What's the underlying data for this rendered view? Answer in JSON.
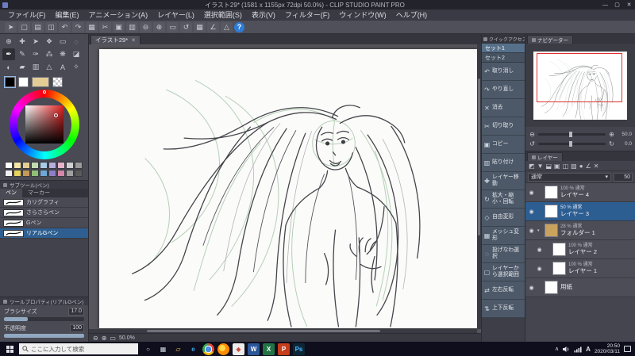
{
  "window": {
    "title": "イラスト29* (1581 x 1155px 72dpi 50.0%) - CLIP STUDIO PAINT PRO",
    "buttons": {
      "minimize": "—",
      "maximize": "▢",
      "close": "✕"
    }
  },
  "menubar": {
    "items": [
      {
        "label": "ファイル(F)"
      },
      {
        "label": "編集(E)"
      },
      {
        "label": "アニメーション(A)"
      },
      {
        "label": "レイヤー(L)"
      },
      {
        "label": "選択範囲(S)"
      },
      {
        "label": "表示(V)"
      },
      {
        "label": "フィルター(F)"
      },
      {
        "label": "ウィンドウ(W)"
      },
      {
        "label": "ヘルプ(H)"
      }
    ]
  },
  "toolbar": {
    "icons": [
      {
        "name": "operation-icon",
        "glyph": "➤"
      },
      {
        "name": "new-canvas-icon",
        "glyph": "▢"
      },
      {
        "name": "open-file-icon",
        "glyph": "▤"
      },
      {
        "name": "save-icon",
        "glyph": "◫"
      },
      {
        "name": "undo-icon",
        "glyph": "↶"
      },
      {
        "name": "redo-icon",
        "glyph": "↷"
      },
      {
        "name": "deselect-icon",
        "glyph": "▦"
      },
      {
        "name": "cut-icon",
        "glyph": "✂"
      },
      {
        "name": "copy-icon",
        "glyph": "▣"
      },
      {
        "name": "paste-icon",
        "glyph": "▥"
      },
      {
        "name": "zoom-out-icon",
        "glyph": "⊖"
      },
      {
        "name": "zoom-in-icon",
        "glyph": "⊕"
      },
      {
        "name": "fit-to-screen-icon",
        "glyph": "▭"
      },
      {
        "name": "rotate-reset-icon",
        "glyph": "↺"
      },
      {
        "name": "grid-icon",
        "glyph": "▦"
      },
      {
        "name": "snap-ruler-icon",
        "glyph": "∠"
      },
      {
        "name": "snap-special-ruler-icon",
        "glyph": "△"
      },
      {
        "name": "help-icon",
        "glyph": "?",
        "accent": true
      }
    ]
  },
  "tool_panel": {
    "tools": [
      {
        "name": "zoom-tool",
        "glyph": "⊕"
      },
      {
        "name": "move-tool",
        "glyph": "✚"
      },
      {
        "name": "operation-tool",
        "glyph": "➤"
      },
      {
        "name": "layer-move-tool",
        "glyph": "❖"
      },
      {
        "name": "marquee-tool",
        "glyph": "▭"
      },
      {
        "name": "lasso-tool",
        "glyph": "◌"
      },
      {
        "name": "pen-tool",
        "glyph": "✒",
        "active": true
      },
      {
        "name": "pencil-tool",
        "glyph": "✎"
      },
      {
        "name": "brush-tool",
        "glyph": "✑"
      },
      {
        "name": "airbrush-tool",
        "glyph": "⁂"
      },
      {
        "name": "decoration-tool",
        "glyph": "❋"
      },
      {
        "name": "eraser-tool",
        "glyph": "◪"
      },
      {
        "name": "blend-tool",
        "glyph": "◐"
      },
      {
        "name": "fill-tool",
        "glyph": "▰"
      },
      {
        "name": "gradient-tool",
        "glyph": "▥"
      },
      {
        "name": "figure-tool",
        "glyph": "△"
      },
      {
        "name": "text-tool",
        "glyph": "A"
      },
      {
        "name": "eyedropper-tool",
        "glyph": "✧"
      }
    ],
    "main_color": "#000000",
    "sub_color": "#ffffff",
    "skin_color": "#e3cd95"
  },
  "palette": {
    "swatches": [
      "#ffffff",
      "#f5e6a8",
      "#e3cd95",
      "#c2dcae",
      "#a8cde4",
      "#b6aede",
      "#e8b4cc",
      "#d0d0d0",
      "#9a9a9a",
      "#f0f0f0",
      "#e8d25e",
      "#c49a58",
      "#8fbf75",
      "#6fa8d4",
      "#8e7fc8",
      "#d487a8",
      "#a0a0a0",
      "#5a5a5a"
    ]
  },
  "subtool": {
    "title": "サブツール(ペン)",
    "tabs": [
      {
        "label": "ペン",
        "active": true
      },
      {
        "label": "マーカー"
      }
    ],
    "items": [
      {
        "label": "カリグラフィ"
      },
      {
        "label": "さらさらペン"
      },
      {
        "label": "Gペン"
      },
      {
        "label": "リアルGペン",
        "selected": true
      }
    ]
  },
  "tool_property": {
    "title": "ツールプロパティ(リアルGペン)",
    "properties": [
      {
        "label": "ブラシサイズ",
        "value": "17.0",
        "fill": "30%"
      },
      {
        "label": "不透明度",
        "value": "100",
        "fill": "100%"
      }
    ]
  },
  "canvas": {
    "tab_label": "イラスト29*",
    "tab_close": "✕",
    "footer": {
      "zoom_out": "⊖",
      "zoom_in": "⊕",
      "fit": "▭",
      "zoom_label": "50.0%"
    }
  },
  "quick_access": {
    "title": "クイックアクセス",
    "sets": [
      {
        "label": "セット1",
        "active": true
      },
      {
        "label": "セット2"
      }
    ],
    "items": [
      {
        "icon": "↶",
        "label": "取り消し"
      },
      {
        "icon": "↷",
        "label": "やり直し"
      },
      {
        "icon": "✕",
        "label": "消去"
      },
      {
        "icon": "✂",
        "label": "切り取り"
      },
      {
        "icon": "▣",
        "label": "コピー"
      },
      {
        "icon": "▥",
        "label": "貼り付け"
      },
      {
        "icon": "✚",
        "label": "レイヤー移動"
      },
      {
        "icon": "↻",
        "label": "拡大・縮小・回転"
      },
      {
        "icon": "◇",
        "label": "自由変形"
      },
      {
        "icon": "▦",
        "label": "メッシュ変形"
      },
      {
        "icon": "◌",
        "label": "投げなわ選択"
      },
      {
        "icon": "▢",
        "label": "レイヤーから選択範囲"
      },
      {
        "icon": "⇄",
        "label": "左右反転"
      },
      {
        "icon": "⇅",
        "label": "上下反転"
      }
    ]
  },
  "navigator": {
    "title": "ナビゲーター",
    "zoom_out": "⊖",
    "zoom_in": "⊕",
    "zoom_value": "50.0",
    "rotate_left": "↺",
    "rotate_right": "↻",
    "rotate_value": "0.0"
  },
  "layers": {
    "title": "レイヤー",
    "toolbar_icons": [
      {
        "name": "layer-color-icon",
        "glyph": "◩"
      },
      {
        "name": "transfer-down-icon",
        "glyph": "▼"
      },
      {
        "name": "combine-icon",
        "glyph": "⬓"
      },
      {
        "name": "clip-at-layer-icon",
        "glyph": "▣"
      },
      {
        "name": "lock-layer-icon",
        "glyph": "◫"
      },
      {
        "name": "lock-alpha-icon",
        "glyph": "▨"
      },
      {
        "name": "mask-icon",
        "glyph": "●"
      },
      {
        "name": "ruler-icon",
        "glyph": "∠"
      },
      {
        "name": "delete-layer-icon",
        "glyph": "✕"
      }
    ],
    "blend_mode": "通常",
    "caret": "▾",
    "opacity_value": "50",
    "rows": [
      {
        "eye": "◉",
        "info": "100 % 通常",
        "name": "レイヤー 4"
      },
      {
        "eye": "◉",
        "info": "50 % 通常",
        "name": "レイヤー 3",
        "selected": true
      },
      {
        "eye": "◉",
        "info": "28 % 通常",
        "name": "フォルダー 1",
        "folder": true,
        "arrow": "▾"
      },
      {
        "eye": "◉",
        "info": "100 % 通常",
        "name": "レイヤー 2",
        "indent": true
      },
      {
        "eye": "◉",
        "info": "100 % 通常",
        "name": "レイヤー 1",
        "indent": true
      },
      {
        "eye": "◉",
        "info": "",
        "name": "用紙"
      }
    ]
  },
  "taskbar": {
    "search_placeholder": "ここに入力して検索",
    "apps": [
      {
        "name": "app-cortana",
        "glyph": "○",
        "bg": "transparent",
        "fg": "#cfd6e0"
      },
      {
        "name": "app-task-view",
        "glyph": "▦",
        "bg": "transparent",
        "fg": "#cfd6e0"
      },
      {
        "name": "app-file-explorer",
        "glyph": "▱",
        "bg": "transparent",
        "fg": "#f0c050"
      },
      {
        "name": "app-edge",
        "glyph": "e",
        "bg": "transparent",
        "fg": "#45a6e8"
      },
      {
        "name": "app-chrome",
        "glyph": "",
        "bg": "radial-gradient(circle at 50% 50%, #4a90e2 0 34%, #ffffff 36% 44%, rgba(0,0,0,0) 45%), conic-gradient(#e8453c 0 33%, #f7b50c 0 66%, #34a853 0)",
        "fg": "#ffffff",
        "round": true
      },
      {
        "name": "app-firefox",
        "glyph": "",
        "bg": "radial-gradient(circle at 40% 40%, #ffd54a 0 30%, #ff8c00 32% 100%)",
        "fg": "#ffffff",
        "round": true
      },
      {
        "name": "app-clip-studio",
        "glyph": "◆",
        "bg": "#ececec",
        "fg": "#cf4a3e"
      },
      {
        "name": "app-word",
        "glyph": "W",
        "bg": "#2b579a",
        "fg": "#ffffff"
      },
      {
        "name": "app-excel",
        "glyph": "X",
        "bg": "#217346",
        "fg": "#ffffff"
      },
      {
        "name": "app-powerpoint",
        "glyph": "P",
        "bg": "#c43e1c",
        "fg": "#ffffff"
      },
      {
        "name": "app-photoshop",
        "glyph": "Ps",
        "bg": "#0d2636",
        "fg": "#4db8ff"
      }
    ],
    "tray": {
      "chevron": "∧",
      "ime": "A",
      "time": "20:50",
      "date": "2020/03/11"
    }
  }
}
